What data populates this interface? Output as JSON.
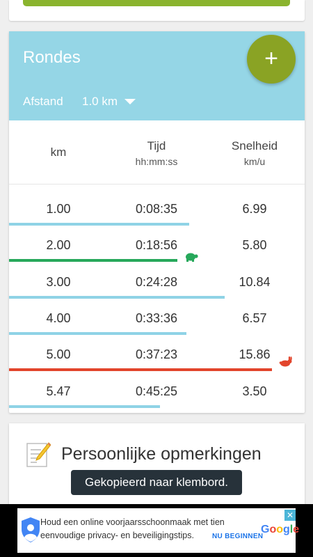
{
  "laps": {
    "title": "Rondes",
    "add_label": "+",
    "distance_label": "Afstand",
    "distance_value": "1.0 km",
    "columns": [
      {
        "title": "km",
        "unit": ""
      },
      {
        "title": "Tijd",
        "unit": "hh:mm:ss"
      },
      {
        "title": "Snelheid",
        "unit": "km/u"
      }
    ],
    "rows": [
      {
        "km": "1.00",
        "time": "0:08:35",
        "speed": "6.99",
        "bar_fraction": 0.61,
        "bar_color": "#8fd3e6",
        "marker": ""
      },
      {
        "km": "2.00",
        "time": "0:18:56",
        "speed": "5.80",
        "bar_fraction": 0.57,
        "bar_color": "#27a85b",
        "marker": "turtle-icon"
      },
      {
        "km": "3.00",
        "time": "0:24:28",
        "speed": "10.84",
        "bar_fraction": 0.73,
        "bar_color": "#8fd3e6",
        "marker": ""
      },
      {
        "km": "4.00",
        "time": "0:33:36",
        "speed": "6.57",
        "bar_fraction": 0.6,
        "bar_color": "#8fd3e6",
        "marker": ""
      },
      {
        "km": "5.00",
        "time": "0:37:23",
        "speed": "15.86",
        "bar_fraction": 0.89,
        "bar_color": "#e2452c",
        "marker": "rabbit-icon"
      },
      {
        "km": "5.47",
        "time": "0:45:25",
        "speed": "3.50",
        "bar_fraction": 0.51,
        "bar_color": "#8fd3e6",
        "marker": ""
      }
    ]
  },
  "notes": {
    "title": "Persoonlijke opmerkingen",
    "icon": "notepad-pencil-icon"
  },
  "toast": {
    "text": "Gekopieerd naar klembord."
  },
  "ad": {
    "line1": "Houd een online voorjaarsschoonmaak met tien",
    "line2": "eenvoudige privacy- en beveiligingstips.",
    "cta": "NU BEGINNEN",
    "logo": "Google",
    "close": "✕"
  },
  "colors": {
    "header_bg": "#95d6e6",
    "fab": "#8aa324",
    "accent_green_bar": "#8ab42e"
  }
}
